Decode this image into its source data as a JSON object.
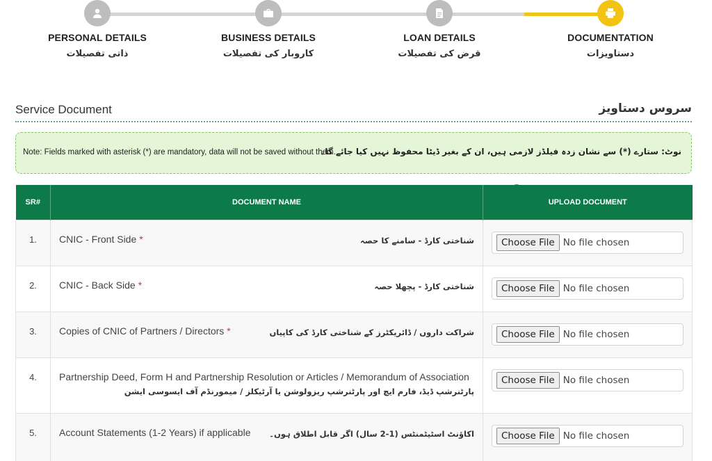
{
  "stepper": {
    "steps": [
      {
        "label_en": "PERSONAL DETAILS",
        "label_ur": "ذاتی تفصیلات",
        "icon": "user-icon",
        "active": false
      },
      {
        "label_en": "BUSINESS DETAILS",
        "label_ur": "کاروبار کی تفصیلات",
        "icon": "briefcase-icon",
        "active": false
      },
      {
        "label_en": "LOAN DETAILS",
        "label_ur": "قرض کی تفصیلات",
        "icon": "document-icon",
        "active": false
      },
      {
        "label_en": "DOCUMENTATION",
        "label_ur": "دستاویزات",
        "icon": "printer-icon",
        "active": true
      }
    ],
    "colors": {
      "active": "#f2c313",
      "inactive": "#bdbdbd"
    }
  },
  "section": {
    "title_en": "Service Document",
    "title_ur": "سروس دستاویز"
  },
  "note": {
    "text_en": "Note: Fields marked with asterisk (*) are mandatory, data will not be saved without them.",
    "text_ur": "نوٹ: ستارے (*) سے نشان زدہ فیلڈز لازمی ہیں، ان کے بغیر ڈیٹا محفوظ نہیں کیا جائے گا۔"
  },
  "table": {
    "headers": {
      "sr": "SR#",
      "name": "DOCUMENT NAME",
      "upload": "UPLOAD DOCUMENT"
    },
    "header_color": "#0d7a4a",
    "rows": [
      {
        "sr": "1.",
        "name_en": "CNIC - Front Side",
        "required": "*",
        "name_ur": "شناختی کارڈ - سامنے کا حصہ"
      },
      {
        "sr": "2.",
        "name_en": "CNIC - Back Side",
        "required": "*",
        "name_ur": "شناختی کارڈ - پچھلا حصہ"
      },
      {
        "sr": "3.",
        "name_en": "Copies of CNIC of Partners / Directors",
        "required": "*",
        "name_ur": "شراکت داروں / ڈائریکٹرز کے شناختی کارڈ کی کاپیاں"
      },
      {
        "sr": "4.",
        "name_en": "Partnership Deed, Form H and Partnership Resolution or Articles / Memorandum of Association",
        "required": "",
        "name_ur": "پارٹنرشپ ڈیڈ، فارم ایچ اور پارٹنرشپ ریزولوشن یا آرٹیکلز / میمورنڈم آف ایسوسی ایشن"
      },
      {
        "sr": "5.",
        "name_en": "Account Statements (1-2 Years) if applicable",
        "required": "",
        "name_ur": "اکاؤنٹ اسٹیٹمنٹس (1-2 سال) اگر قابل اطلاق ہوں۔"
      }
    ],
    "file_input": {
      "button_label": "Choose File",
      "status": "No file chosen"
    }
  }
}
